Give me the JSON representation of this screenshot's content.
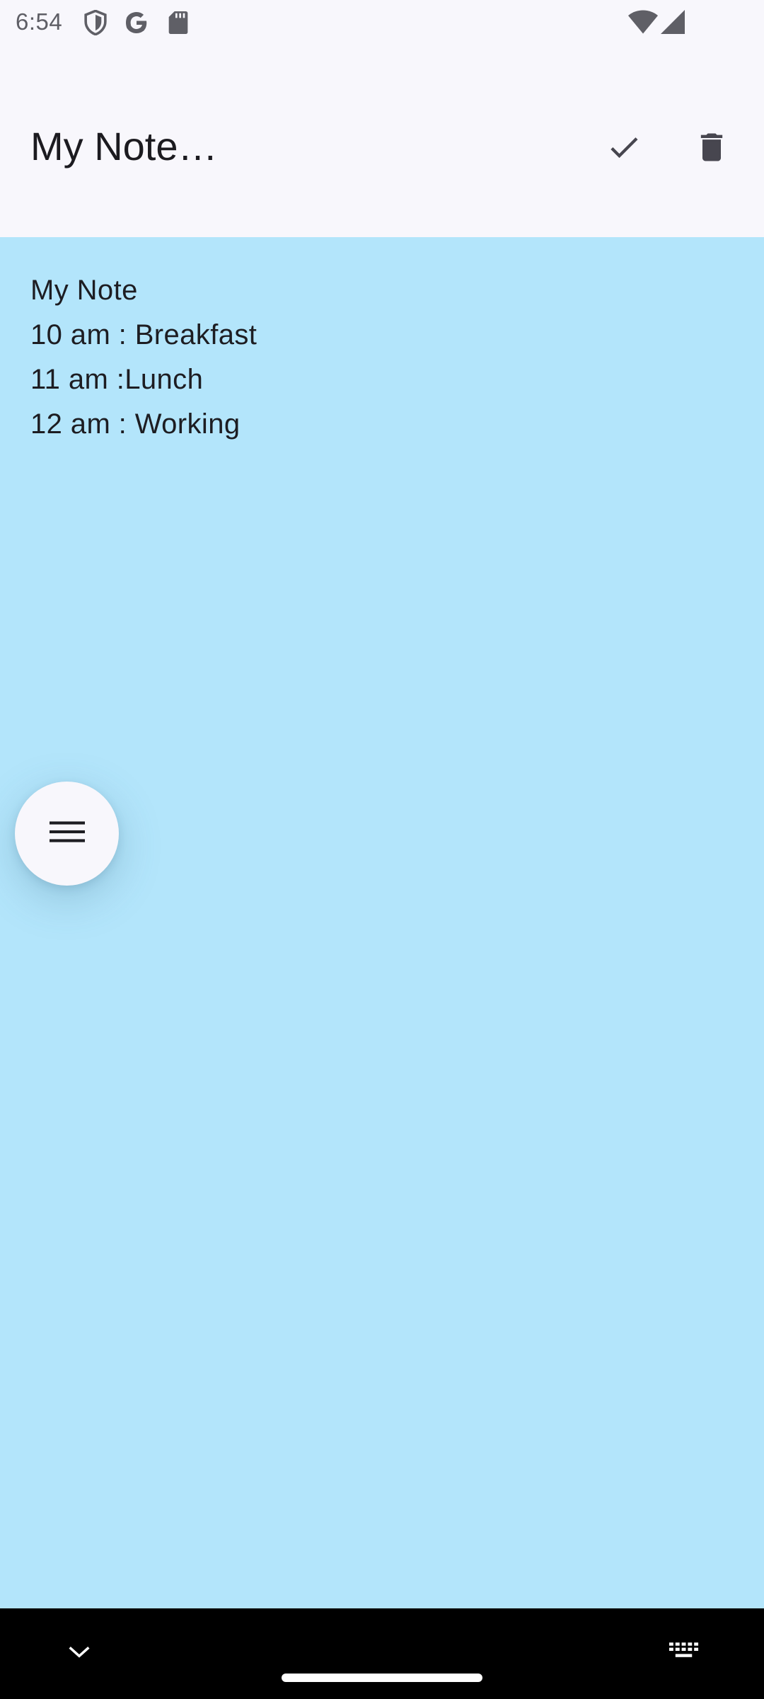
{
  "status_bar": {
    "time": "6:54",
    "icons": [
      "shield-icon",
      "google-icon",
      "sd-card-icon",
      "wifi-icon",
      "signal-icon"
    ]
  },
  "app_bar": {
    "title": "My Note…",
    "actions": [
      "check-icon",
      "delete-icon"
    ]
  },
  "note": {
    "background_color": "#b3e5fb",
    "lines": [
      "My Note",
      "10 am : Breakfast",
      "11 am :Lunch",
      "12 am : Working"
    ]
  },
  "fab": {
    "icon": "menu-icon"
  },
  "nav_bar": {
    "icons": [
      "chevron-down-icon",
      "keyboard-icon"
    ]
  }
}
